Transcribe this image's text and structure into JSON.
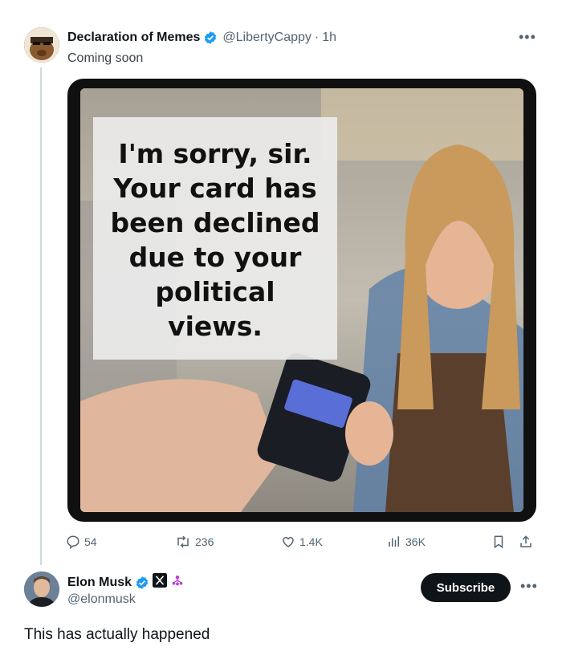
{
  "post": {
    "author_name": "Declaration of Memes",
    "handle": "@LibertyCappy",
    "separator": "·",
    "time": "1h",
    "text": "Coming soon",
    "meme_lines": [
      "I'm sorry, sir.",
      "Your card has",
      "been declined",
      "due to your",
      "political",
      "views."
    ],
    "actions": {
      "replies": "54",
      "reposts": "236",
      "likes": "1.4K",
      "views": "36K"
    }
  },
  "reply": {
    "author_name": "Elon Musk",
    "handle": "@elonmusk",
    "text": "This has actually happened",
    "subscribe_label": "Subscribe"
  },
  "colors": {
    "verified_blue": "#1d9bf0",
    "muted_text": "#536471",
    "subscribe_bg": "#0f1419",
    "thread_line": "#cfd9de"
  },
  "icons": [
    "more-icon",
    "verified-badge-icon",
    "reply-icon",
    "repost-icon",
    "like-icon",
    "views-icon",
    "bookmark-icon",
    "share-icon",
    "x-logo-icon",
    "affiliate-icon"
  ]
}
